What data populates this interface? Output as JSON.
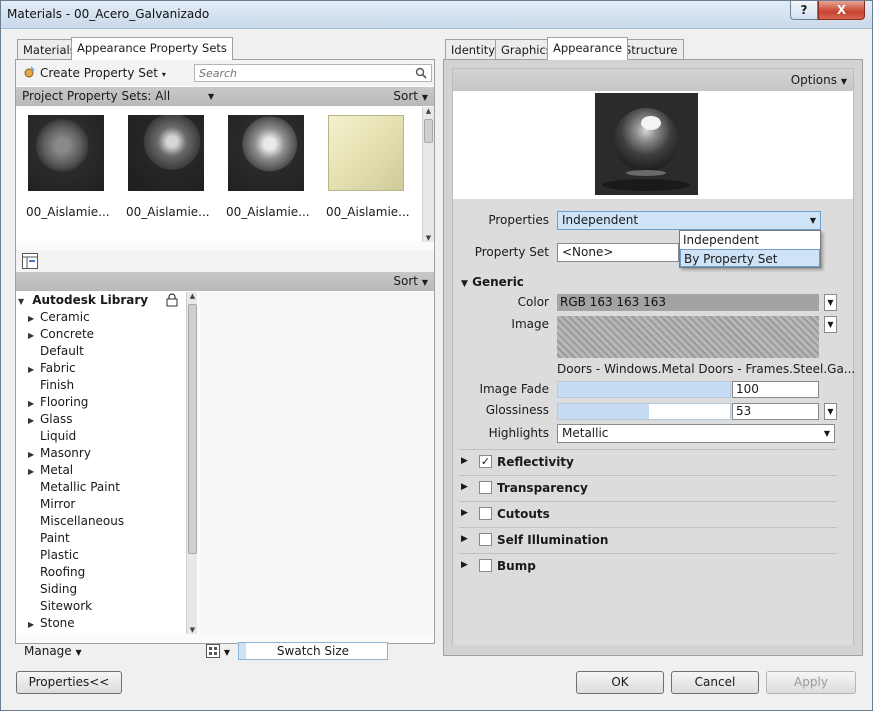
{
  "window": {
    "title": "Materials - 00_Acero_Galvanizado",
    "help": "?",
    "close": "X"
  },
  "left": {
    "tabs": [
      "Materials",
      "Appearance Property Sets"
    ],
    "create_label": "Create Property Set",
    "search_placeholder": "Search",
    "filter_label": "Project Property Sets: All",
    "sort_label": "Sort",
    "swatches": [
      "00_Aislamie...",
      "00_Aislamie...",
      "00_Aislamie...",
      "00_Aislamie..."
    ],
    "sort_label_2": "Sort",
    "library_title": "Autodesk Library",
    "tree": [
      {
        "label": "Ceramic",
        "expandable": true
      },
      {
        "label": "Concrete",
        "expandable": true
      },
      {
        "label": "Default",
        "expandable": false
      },
      {
        "label": "Fabric",
        "expandable": true
      },
      {
        "label": "Finish",
        "expandable": false
      },
      {
        "label": "Flooring",
        "expandable": true
      },
      {
        "label": "Glass",
        "expandable": true
      },
      {
        "label": "Liquid",
        "expandable": false
      },
      {
        "label": "Masonry",
        "expandable": true
      },
      {
        "label": "Metal",
        "expandable": true
      },
      {
        "label": "Metallic Paint",
        "expandable": false
      },
      {
        "label": "Mirror",
        "expandable": false
      },
      {
        "label": "Miscellaneous",
        "expandable": false
      },
      {
        "label": "Paint",
        "expandable": false
      },
      {
        "label": "Plastic",
        "expandable": false
      },
      {
        "label": "Roofing",
        "expandable": false
      },
      {
        "label": "Siding",
        "expandable": false
      },
      {
        "label": "Sitework",
        "expandable": false
      },
      {
        "label": "Stone",
        "expandable": true
      }
    ],
    "manage_label": "Manage",
    "swatch_size_label": "Swatch Size",
    "swatch_size_level": 0.05
  },
  "right": {
    "tabs": [
      "Identity",
      "Graphics",
      "Appearance",
      "Structure"
    ],
    "options_label": "Options",
    "properties_label": "Properties",
    "properties_value": "Independent",
    "popup_options": [
      "Independent",
      "By Property Set"
    ],
    "property_set_label": "Property Set",
    "property_set_value": "<None>",
    "generic_header": "Generic",
    "color_label": "Color",
    "color_value": "RGB 163 163 163",
    "image_label": "Image",
    "image_name": "Doors - Windows.Metal Doors - Frames.Steel.Ga...",
    "image_fade_label": "Image Fade",
    "image_fade_value": "100",
    "image_fade_level": 1.0,
    "glossiness_label": "Glossiness",
    "glossiness_value": "53",
    "glossiness_level": 0.53,
    "highlights_label": "Highlights",
    "highlights_value": "Metallic",
    "sections": [
      {
        "label": "Reflectivity",
        "checked": true
      },
      {
        "label": "Transparency",
        "checked": false
      },
      {
        "label": "Cutouts",
        "checked": false
      },
      {
        "label": "Self Illumination",
        "checked": false
      },
      {
        "label": "Bump",
        "checked": false
      }
    ]
  },
  "footer": {
    "properties_btn": "Properties<<",
    "ok_btn": "OK",
    "cancel_btn": "Cancel",
    "apply_btn": "Apply"
  },
  "colors": {
    "accent": "#cfe3f7",
    "color_swatch": "#a3a3a3",
    "close_red": "#c7432f"
  }
}
